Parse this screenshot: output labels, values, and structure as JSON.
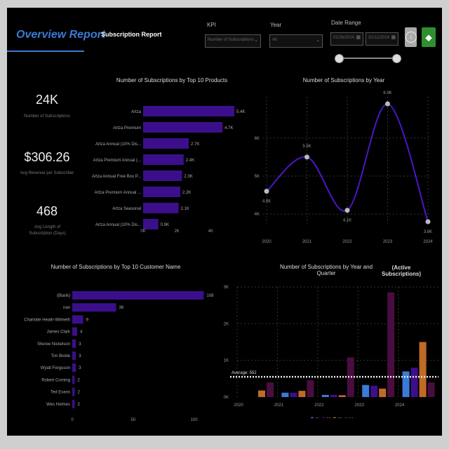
{
  "header": {
    "title": "Overview Report",
    "subscription_tab": "Subscription Report"
  },
  "filters": {
    "kpi_label": "KPI",
    "kpi_value": "Number of Subscriptions",
    "year_label": "Year",
    "year_value": "All",
    "date_range_label": "Date Range",
    "date_start": "01/26/2020",
    "date_end": "31/12/2024",
    "range_start_fraction": 0,
    "range_end_fraction": 1
  },
  "buttons": {
    "info_icon": "info-icon",
    "green_icon": "diamond-arrow-icon"
  },
  "kpis": [
    {
      "value": "24K",
      "label": "Number of Subscriptions"
    },
    {
      "value": "$306.26",
      "label": "Avg Revenue per Subscriber"
    },
    {
      "value": "468",
      "label": "Avg Length of Subscription (Days)"
    }
  ],
  "colors": {
    "bar": "#3b0f8c",
    "line": "#4b16c4",
    "q1": "#3a7bd5",
    "q2": "#3b0f8c",
    "q3": "#c06a28",
    "q4": "#4a0d3f"
  },
  "chart_data": [
    {
      "type": "bar",
      "orientation": "horizontal",
      "title": "Number of Subscriptions by Top 10 Products",
      "categories": [
        "Artza",
        "Artza Premium",
        "Artza Annual (10% Dis...",
        "Artza Premium Annual (...",
        "Artza Annual Free Box P...",
        "Artza Premium Annual ...",
        "Artza Seasonal",
        "Artza Annual (10% Dis..."
      ],
      "values": [
        5400,
        4700,
        2700,
        2400,
        2300,
        2200,
        2100,
        900
      ],
      "data_labels": [
        "5.4K",
        "4.7K",
        "2.7K",
        "2.4K",
        "2.3K",
        "2.2K",
        "2.1K",
        "0.9K"
      ],
      "x_ticks": [
        "0K",
        "2K",
        "4K"
      ],
      "xlim": [
        0,
        5400
      ]
    },
    {
      "type": "line",
      "title": "Number of Subscriptions by Year",
      "x": [
        "2020",
        "2021",
        "2022",
        "2023",
        "2024"
      ],
      "values": [
        4600,
        5500,
        4100,
        6900,
        3800
      ],
      "data_labels": [
        "4.6K",
        "5.5K",
        "4.1K",
        "6.9K",
        "3.8K"
      ],
      "y_ticks": [
        "4K",
        "5K",
        "6K"
      ],
      "ylim": [
        3800,
        6900
      ],
      "grid": true
    },
    {
      "type": "bar",
      "orientation": "horizontal",
      "title": "Number of Subscriptions by Top 10 Customer Name",
      "categories": [
        "(Blank)",
        "nan",
        "Charlotte Heath-Wilmeth",
        "James Clark",
        "Sheree Nickelson",
        "Tim Bickle",
        "Wyatt Ferguson",
        "Robert Corning",
        "Ted Evans",
        "Wes Holmes"
      ],
      "values": [
        108,
        36,
        9,
        4,
        3,
        3,
        3,
        2,
        2,
        2
      ],
      "data_labels": [
        "108",
        "36",
        "9",
        "4",
        "3",
        "3",
        "3",
        "2",
        "2",
        "2"
      ],
      "x_ticks": [
        "0",
        "50",
        "100"
      ],
      "xlim": [
        0,
        125
      ]
    },
    {
      "type": "bar",
      "title": "Number of Subscriptions by Year and Quarter",
      "subtitle": "(Active Subscriptions)",
      "categories": [
        "2020",
        "2021",
        "2022",
        "2023",
        "2024"
      ],
      "series": [
        {
          "name": "Q1",
          "values": [
            0,
            120,
            60,
            330,
            700
          ]
        },
        {
          "name": "Q2",
          "values": [
            0,
            120,
            60,
            310,
            800
          ]
        },
        {
          "name": "Q3",
          "values": [
            180,
            170,
            50,
            230,
            1500
          ]
        },
        {
          "name": "Q4",
          "values": [
            400,
            460,
            1080,
            2850,
            400
          ]
        }
      ],
      "y_ticks": [
        "0K",
        "1K",
        "2K",
        "3K"
      ],
      "ylim": [
        0,
        3000
      ],
      "average_line": {
        "label": "Average: 552",
        "value": 552
      },
      "legend": "bottom"
    }
  ]
}
